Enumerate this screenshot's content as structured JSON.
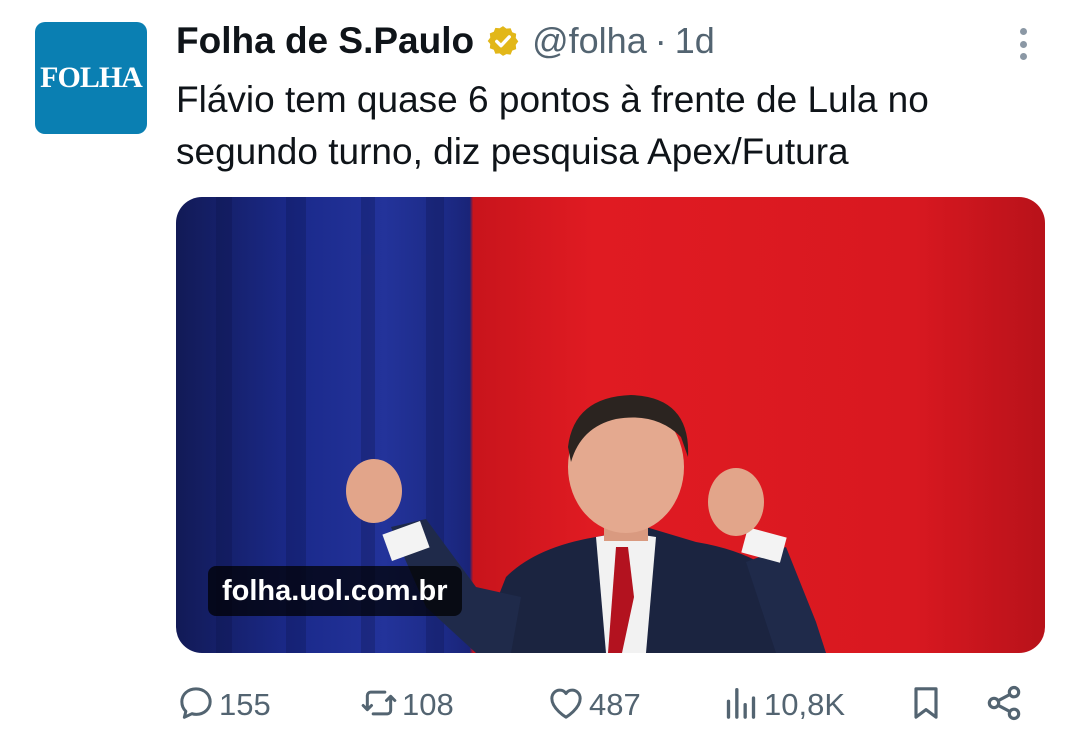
{
  "tweet": {
    "author_name": "Folha de S.Paulo",
    "handle": "@folha",
    "separator": "·",
    "time": "1d",
    "avatar_text": "FOLHA",
    "text": "Flávio tem quase 6 pontos à frente de Lula no segundo turno, diz pesquisa Apex/Futura",
    "link_domain": "folha.uol.com.br"
  },
  "actions": {
    "replies": "155",
    "reposts": "108",
    "likes": "487",
    "views": "10,8K"
  },
  "icons": {
    "verified": "verified-badge-icon",
    "more": "more-options-icon",
    "reply": "reply-icon",
    "repost": "repost-icon",
    "like": "heart-icon",
    "views": "views-icon",
    "bookmark": "bookmark-icon",
    "share": "share-icon"
  },
  "colors": {
    "verified_gold": "#e2b719",
    "secondary_text": "#536471",
    "avatar_bg": "#0a7fb2"
  }
}
